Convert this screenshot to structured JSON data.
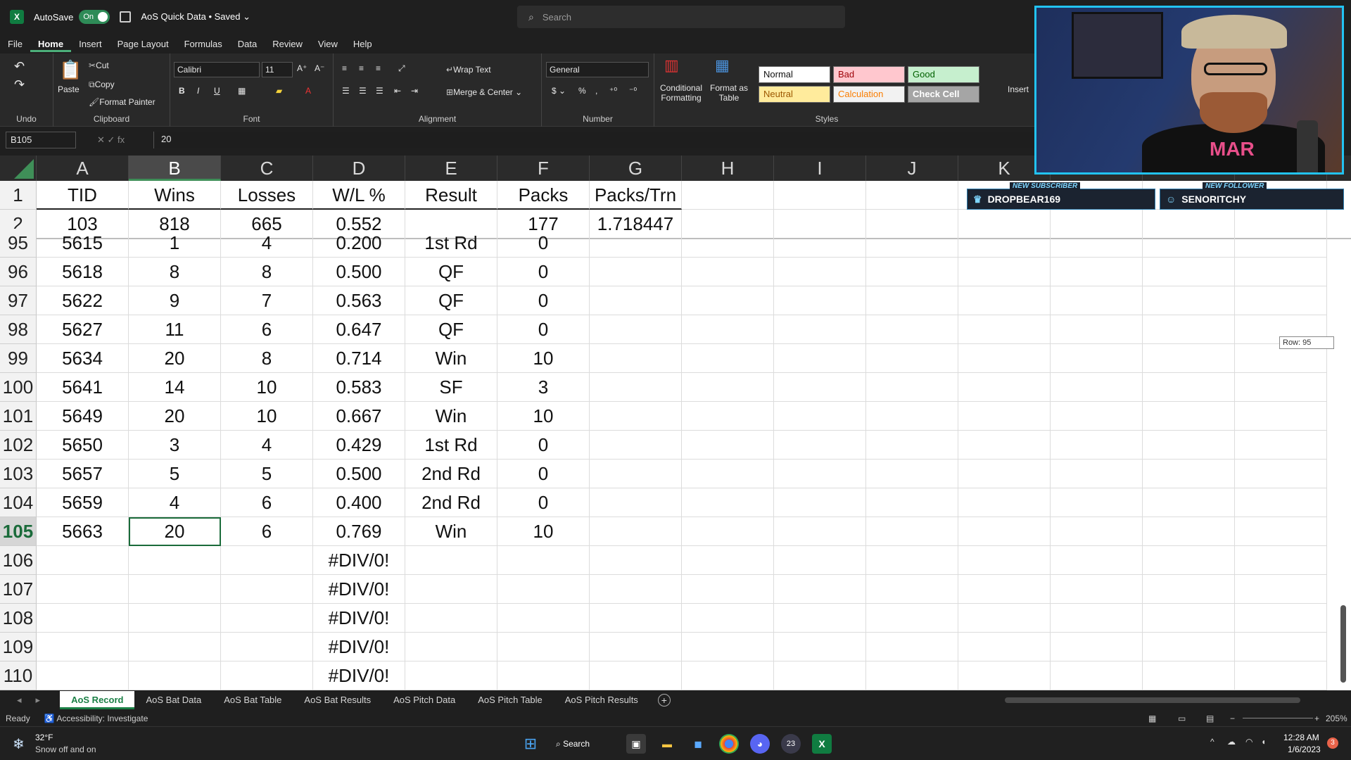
{
  "titlebar": {
    "autosave_label": "AutoSave",
    "autosave_state": "On",
    "doc_title": "AoS Quick Data • Saved ⌄",
    "search_placeholder": "Search"
  },
  "menu": [
    "File",
    "Home",
    "Insert",
    "Page Layout",
    "Formulas",
    "Data",
    "Review",
    "View",
    "Help"
  ],
  "ribbon": {
    "undo_label": "Undo",
    "clipboard": {
      "paste": "Paste",
      "cut": "Cut",
      "copy": "Copy",
      "format_painter": "Format Painter",
      "label": "Clipboard"
    },
    "font": {
      "family": "Calibri",
      "size": "11",
      "label": "Font"
    },
    "alignment": {
      "wrap": "Wrap Text",
      "merge": "Merge & Center",
      "label": "Alignment"
    },
    "number": {
      "format": "General",
      "label": "Number"
    },
    "styles": {
      "conditional": "Conditional Formatting",
      "format_table": "Format as Table",
      "normal": "Normal",
      "bad": "Bad",
      "good": "Good",
      "neutral": "Neutral",
      "calculation": "Calculation",
      "check_cell": "Check Cell",
      "label": "Styles"
    },
    "insert": "Insert"
  },
  "formula_bar": {
    "name_box": "B105",
    "formula": "20"
  },
  "grid": {
    "columns": [
      "A",
      "B",
      "C",
      "D",
      "E",
      "F",
      "G",
      "H",
      "I",
      "J",
      "K",
      "",
      "",
      ""
    ],
    "header_rows": [
      {
        "row": "1",
        "cells": [
          "TID",
          "Wins",
          "Losses",
          "W/L %",
          "Result",
          "Packs",
          "Packs/Trn"
        ]
      },
      {
        "row": "2",
        "cells": [
          "103",
          "818",
          "665",
          "0.552",
          "",
          "177",
          "1.718447"
        ]
      }
    ],
    "rows": [
      {
        "row": "95",
        "cells": [
          "5615",
          "1",
          "4",
          "0.200",
          "1st Rd",
          "0",
          ""
        ]
      },
      {
        "row": "96",
        "cells": [
          "5618",
          "8",
          "8",
          "0.500",
          "QF",
          "0",
          ""
        ]
      },
      {
        "row": "97",
        "cells": [
          "5622",
          "9",
          "7",
          "0.563",
          "QF",
          "0",
          ""
        ]
      },
      {
        "row": "98",
        "cells": [
          "5627",
          "11",
          "6",
          "0.647",
          "QF",
          "0",
          ""
        ]
      },
      {
        "row": "99",
        "cells": [
          "5634",
          "20",
          "8",
          "0.714",
          "Win",
          "10",
          ""
        ]
      },
      {
        "row": "100",
        "cells": [
          "5641",
          "14",
          "10",
          "0.583",
          "SF",
          "3",
          ""
        ]
      },
      {
        "row": "101",
        "cells": [
          "5649",
          "20",
          "10",
          "0.667",
          "Win",
          "10",
          ""
        ]
      },
      {
        "row": "102",
        "cells": [
          "5650",
          "3",
          "4",
          "0.429",
          "1st Rd",
          "0",
          ""
        ]
      },
      {
        "row": "103",
        "cells": [
          "5657",
          "5",
          "5",
          "0.500",
          "2nd Rd",
          "0",
          ""
        ]
      },
      {
        "row": "104",
        "cells": [
          "5659",
          "4",
          "6",
          "0.400",
          "2nd Rd",
          "0",
          ""
        ]
      },
      {
        "row": "105",
        "cells": [
          "5663",
          "20",
          "6",
          "0.769",
          "Win",
          "10",
          ""
        ]
      },
      {
        "row": "106",
        "cells": [
          "",
          "",
          "",
          "#DIV/0!",
          "",
          "",
          ""
        ]
      },
      {
        "row": "107",
        "cells": [
          "",
          "",
          "",
          "#DIV/0!",
          "",
          "",
          ""
        ]
      },
      {
        "row": "108",
        "cells": [
          "",
          "",
          "",
          "#DIV/0!",
          "",
          "",
          ""
        ]
      },
      {
        "row": "109",
        "cells": [
          "",
          "",
          "",
          "#DIV/0!",
          "",
          "",
          ""
        ]
      },
      {
        "row": "110",
        "cells": [
          "",
          "",
          "",
          "#DIV/0!",
          "",
          "",
          ""
        ]
      }
    ],
    "row_tooltip": "Row: 95"
  },
  "sheets": [
    "AoS Record",
    "AoS Bat Data",
    "AoS Bat Table",
    "AoS Bat Results",
    "AoS Pitch Data",
    "AoS Pitch Table",
    "AoS Pitch Results"
  ],
  "status": {
    "ready": "Ready",
    "accessibility": "Accessibility: Investigate",
    "zoom": "205%"
  },
  "taskbar": {
    "weather_temp": "32°F",
    "weather_desc": "Snow off and on",
    "search": "Search",
    "time": "12:28 AM",
    "date": "1/6/2023",
    "notif": "3"
  },
  "webcam": {
    "shirt_text": "MAR",
    "alert1_label": "NEW SUBSCRIBER",
    "alert1_name": "DROPBEAR169",
    "alert2_label": "NEW FOLLOWER",
    "alert2_name": "SENORITCHY"
  },
  "colors": {
    "accent": "#107c41",
    "cam_border": "#22c3f2"
  }
}
